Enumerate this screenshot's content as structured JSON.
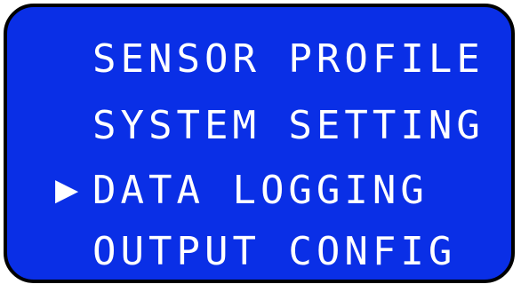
{
  "menu": {
    "cursor_icon": "right-triangle-cursor-icon",
    "cursor_glyph": "▶",
    "selected_index": 2,
    "items": [
      {
        "label": "SENSOR PROFILE"
      },
      {
        "label": "SYSTEM SETTING"
      },
      {
        "label": "DATA LOGGING"
      },
      {
        "label": "OUTPUT CONFIG"
      }
    ]
  },
  "colors": {
    "screen_background": "#0a2fe6",
    "text": "#ffffff",
    "border": "#000000"
  }
}
